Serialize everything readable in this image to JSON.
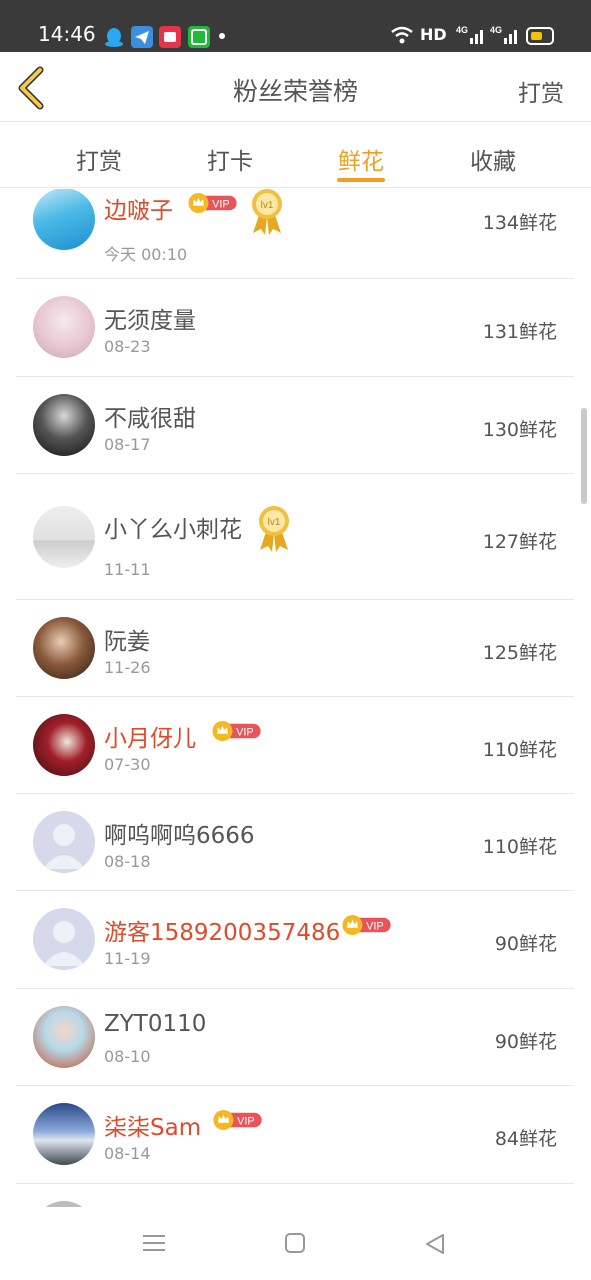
{
  "status_bar": {
    "time": "14:46",
    "app_icons": [
      "qq-icon",
      "telegram-icon",
      "app-red-icon",
      "iqiyi-icon"
    ],
    "right_text": "HD 4G 4G",
    "battery_color": "#f5c400"
  },
  "header": {
    "title": "粉丝荣誉榜",
    "right_action": "打赏"
  },
  "tabs": [
    {
      "label": "打赏"
    },
    {
      "label": "打卡"
    },
    {
      "label": "鲜花"
    },
    {
      "label": "收藏"
    }
  ],
  "active_tab": "鲜花",
  "colors": {
    "accent": "#f0a020",
    "vip_name": "#e04a2a",
    "vip_badge": "#e9535a"
  },
  "badges": {
    "vip": "VIP",
    "level": "lv1"
  },
  "fans": [
    {
      "name": "边啵子",
      "date": "今天 00:10",
      "count": "134鲜花",
      "vip": true,
      "medal": true
    },
    {
      "name": "无须度量",
      "date": "08-23",
      "count": "131鲜花",
      "vip": false,
      "medal": false
    },
    {
      "name": "不咸很甜",
      "date": "08-17",
      "count": "130鲜花",
      "vip": false,
      "medal": false
    },
    {
      "name": "小丫么小刺花",
      "date": "11-11",
      "count": "127鲜花",
      "vip": false,
      "medal": true
    },
    {
      "name": "阮姜",
      "date": "11-26",
      "count": "125鲜花",
      "vip": false,
      "medal": false
    },
    {
      "name": "小月伢儿",
      "date": "07-30",
      "count": "110鲜花",
      "vip": true,
      "medal": false
    },
    {
      "name": "啊呜啊呜6666",
      "date": "08-18",
      "count": "110鲜花",
      "vip": false,
      "medal": false
    },
    {
      "name": "游客1589200357486",
      "date": "11-19",
      "count": "90鲜花",
      "vip": true,
      "medal": false
    },
    {
      "name": "ZYT0110",
      "date": "08-10",
      "count": "90鲜花",
      "vip": false,
      "medal": false
    },
    {
      "name": "柒柒Sam",
      "date": "08-14",
      "count": "84鲜花",
      "vip": true,
      "medal": false
    }
  ],
  "navbar": [
    "menu-icon",
    "home-square-icon",
    "back-triangle-icon"
  ]
}
